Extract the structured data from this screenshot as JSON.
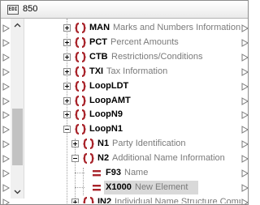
{
  "window": {
    "title": "850",
    "icon_label": "EDI"
  },
  "colors": {
    "bracket": "#a8232a",
    "desc": "#7a7a7a",
    "selected": "#d9d9d9"
  },
  "tree": {
    "rows": [
      {
        "code": "MAN",
        "desc": "Marks and Numbers Information",
        "icon": "segment-icon",
        "expander": "plus"
      },
      {
        "code": "PCT",
        "desc": "Percent Amounts",
        "icon": "segment-icon",
        "expander": "plus"
      },
      {
        "code": "CTB",
        "desc": "Restrictions/Conditions",
        "icon": "segment-icon",
        "expander": "plus"
      },
      {
        "code": "TXI",
        "desc": "Tax Information",
        "icon": "segment-icon",
        "expander": "plus"
      },
      {
        "code": "LoopLDT",
        "desc": "",
        "icon": "segment-icon",
        "expander": "plus"
      },
      {
        "code": "LoopAMT",
        "desc": "",
        "icon": "segment-icon",
        "expander": "plus"
      },
      {
        "code": "LoopN9",
        "desc": "",
        "icon": "segment-icon",
        "expander": "plus"
      },
      {
        "code": "LoopN1",
        "desc": "",
        "icon": "segment-icon",
        "expander": "minus"
      },
      {
        "code": "N1",
        "desc": "Party Identification",
        "icon": "segment-icon",
        "expander": "plus"
      },
      {
        "code": "N2",
        "desc": "Additional Name Information",
        "icon": "segment-icon",
        "expander": "minus"
      },
      {
        "code": "F93",
        "desc": "Name",
        "icon": "field-icon",
        "expander": "none"
      },
      {
        "code": "X1000",
        "desc": "New Element",
        "icon": "field-icon",
        "expander": "none",
        "selected": true
      },
      {
        "code": "IN2",
        "desc": "Individual Name Structure Compon",
        "icon": "segment-icon",
        "expander": "plus"
      }
    ]
  }
}
